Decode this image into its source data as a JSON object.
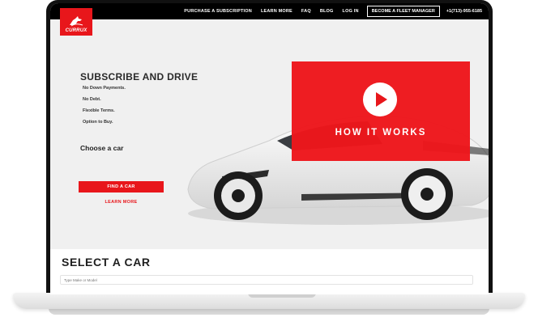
{
  "nav": {
    "links": [
      "PURCHASE A SUBSCRIPTION",
      "LEARN MORE",
      "FAQ",
      "BLOG",
      "LOG IN"
    ],
    "cta": "BECOME A FLEET MANAGER",
    "phone": "+1(713)-955-6185"
  },
  "logo": {
    "text": "CURRUX"
  },
  "hero": {
    "title": "SUBSCRIBE AND DRIVE",
    "features": [
      "No Down Payments.",
      "No Debt.",
      "Flexible Terms.",
      "Option to Buy."
    ],
    "choose": "Choose a car",
    "find_button": "FIND A CAR",
    "learn_link": "LEARN MORE",
    "how_it_works": "HOW IT WORKS"
  },
  "select": {
    "title": "SELECT A CAR",
    "placeholder": "Type Make or Model"
  },
  "colors": {
    "brand": "#e8161b",
    "nav_bg": "#000000"
  }
}
